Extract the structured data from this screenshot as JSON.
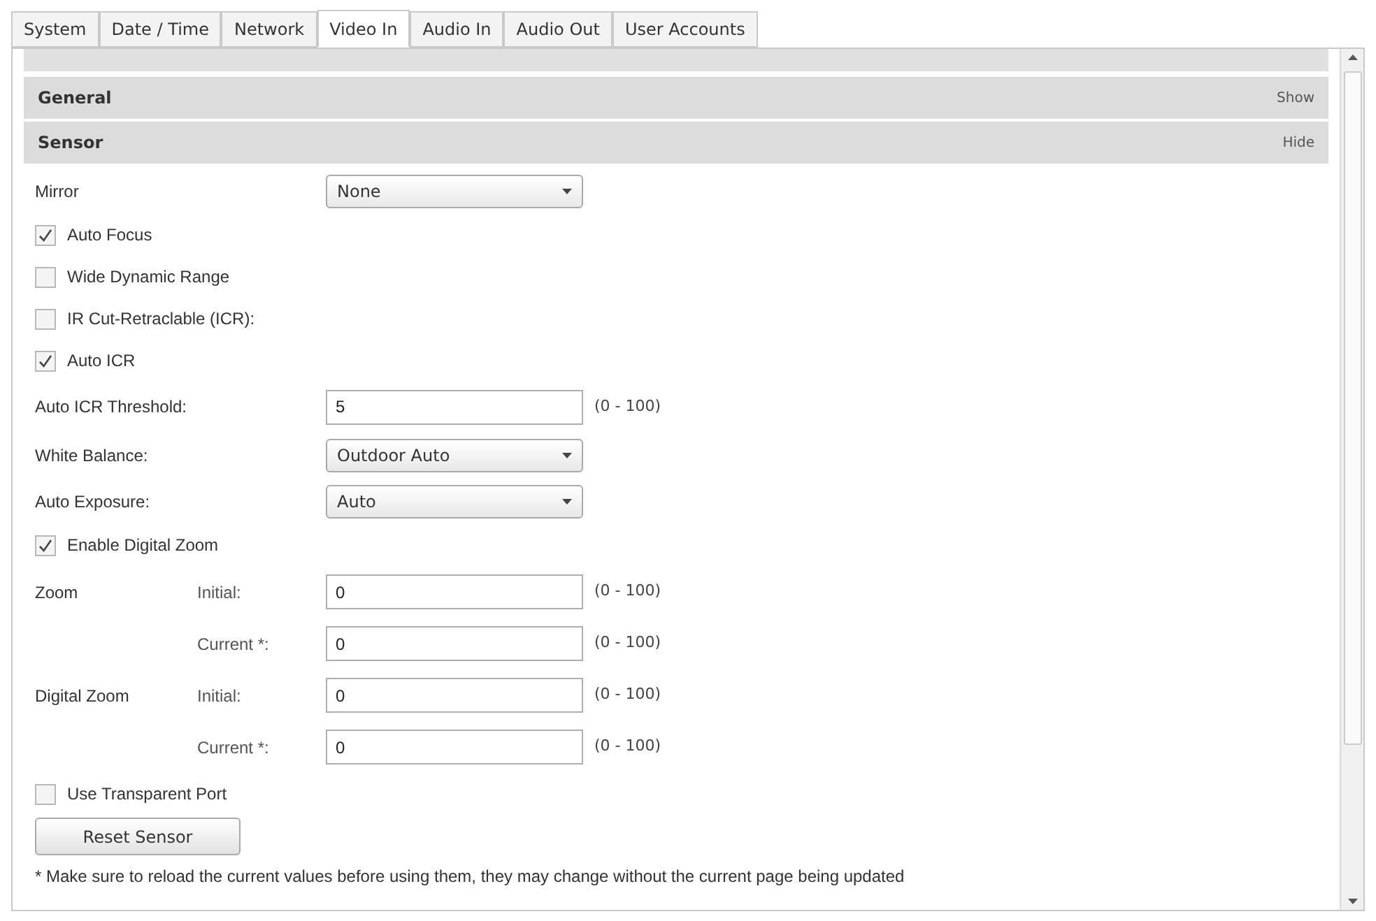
{
  "tabs": [
    {
      "label": "System",
      "selected": false
    },
    {
      "label": "Date / Time",
      "selected": false
    },
    {
      "label": "Network",
      "selected": false
    },
    {
      "label": "Video In",
      "selected": true
    },
    {
      "label": "Audio In",
      "selected": false
    },
    {
      "label": "Audio Out",
      "selected": false
    },
    {
      "label": "User Accounts",
      "selected": false
    }
  ],
  "sections": [
    {
      "title": "General",
      "toggle": "Show"
    },
    {
      "title": "Sensor",
      "toggle": "Hide"
    }
  ],
  "rows": [
    {
      "kind": "select",
      "label": "Mirror",
      "value": "None"
    },
    {
      "kind": "checkbox",
      "label": "Auto Focus",
      "checked": true
    },
    {
      "kind": "checkbox",
      "label": "Wide Dynamic Range",
      "checked": false
    },
    {
      "kind": "checkbox",
      "label": "IR Cut-Retraclable (ICR):",
      "checked": false
    },
    {
      "kind": "checkbox",
      "label": "Auto ICR",
      "checked": true
    },
    {
      "kind": "input",
      "label": "Auto ICR Threshold:",
      "value": "5",
      "range": "(0 - 100)"
    },
    {
      "kind": "select",
      "label": "White Balance:",
      "value": "Outdoor Auto"
    },
    {
      "kind": "select",
      "label": "Auto Exposure:",
      "value": "Auto"
    },
    {
      "kind": "checkbox",
      "label": "Enable Digital Zoom",
      "checked": true
    },
    {
      "kind": "subinput",
      "label": "Zoom",
      "sublabel": "Initial:",
      "value": "0",
      "range": "(0 - 100)"
    },
    {
      "kind": "subinput",
      "sublabel": "Current *:",
      "value": "0",
      "range": "(0 - 100)"
    },
    {
      "kind": "subinput",
      "label": "Digital Zoom",
      "sublabel": "Initial:",
      "value": "0",
      "range": "(0 - 100)"
    },
    {
      "kind": "subinput",
      "sublabel": "Current *:",
      "value": "0",
      "range": "(0 - 100)"
    },
    {
      "kind": "checkbox",
      "label": "Use Transparent Port",
      "checked": false
    }
  ],
  "reset_button": "Reset Sensor",
  "footnote": "* Make sure to reload the current values before using them, they may change without the current page being updated"
}
